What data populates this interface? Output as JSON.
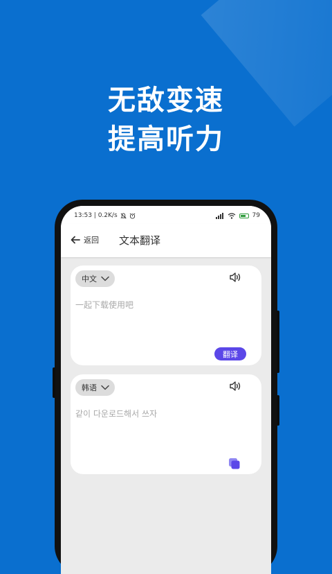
{
  "promo": {
    "line1": "无敌变速",
    "line2": "提高听力"
  },
  "status_bar": {
    "time_speed": "13:53 | 0.2K/s",
    "battery": "79",
    "battery_level": 0.79
  },
  "header": {
    "back_label": "返回",
    "title": "文本翻译"
  },
  "source": {
    "language": "中文",
    "text": "一起下载使用吧",
    "translate_label": "翻译"
  },
  "target": {
    "language": "韩语",
    "text": "같이 다운로드해서 쓰자"
  },
  "colors": {
    "background": "#0a6fcf",
    "accent": "#5b47e8"
  },
  "icons": {
    "back": "arrow-left-icon",
    "dropdown": "chevron-down-icon",
    "speaker": "speaker-icon",
    "copy": "copy-icon"
  }
}
